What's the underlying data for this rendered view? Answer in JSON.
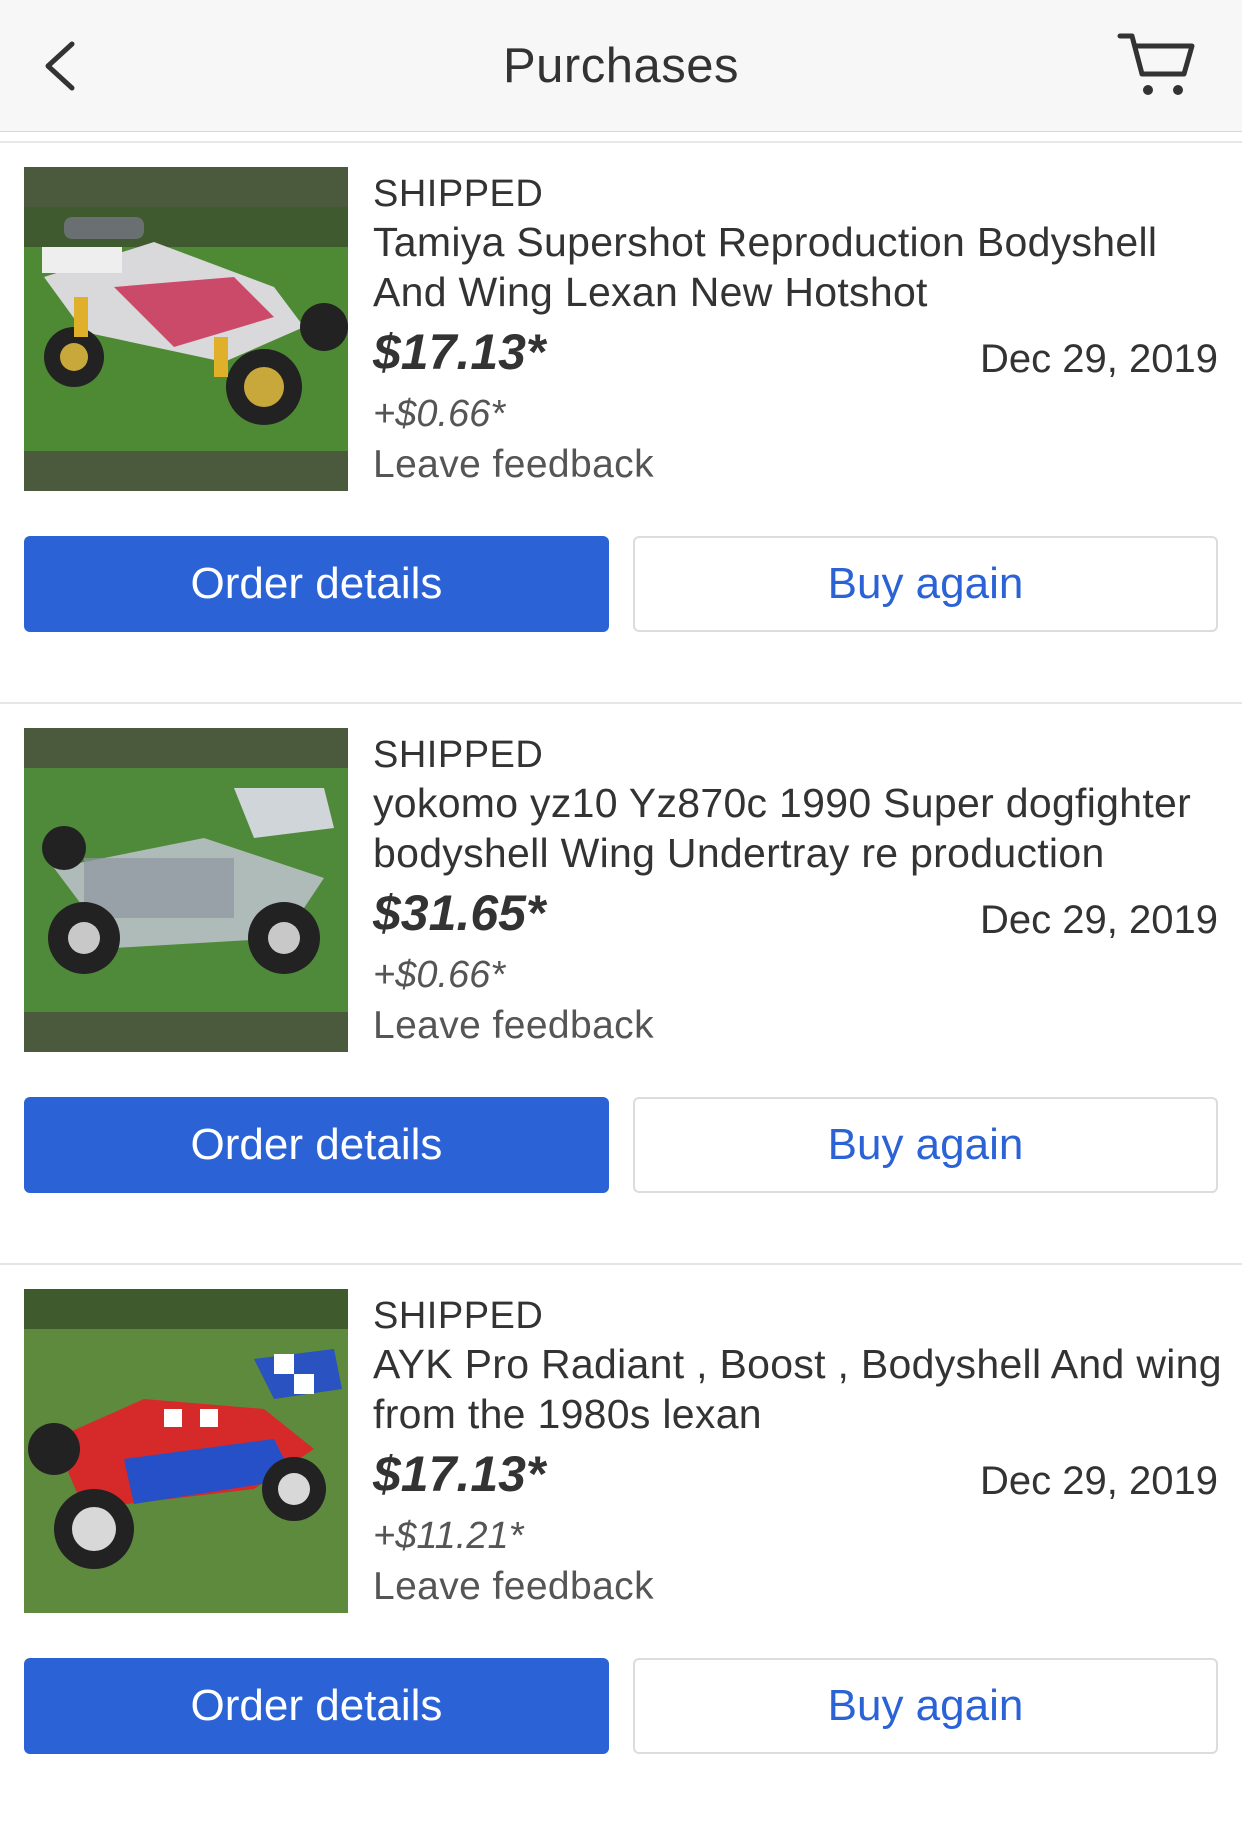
{
  "header": {
    "title": "Purchases",
    "back_icon": "chevron-left-icon",
    "cart_icon": "cart-icon"
  },
  "colors": {
    "primary": "#2b63d6",
    "text": "#333333",
    "nav_bg": "#f7f7f7"
  },
  "purchases": [
    {
      "status": "SHIPPED",
      "title": "Tamiya Supershot Reproduction Bodyshell And Wing Lexan New Hotshot",
      "price": "$17.13*",
      "shipping": "+$0.66*",
      "date": "Dec 29, 2019",
      "feedback": "Leave feedback",
      "order_details_label": "Order details",
      "buy_again_label": "Buy again"
    },
    {
      "status": "SHIPPED",
      "title": "yokomo yz10 Yz870c 1990 Super dogfighter bodyshell Wing Undertray re production",
      "price": "$31.65*",
      "shipping": "+$0.66*",
      "date": "Dec 29, 2019",
      "feedback": "Leave feedback",
      "order_details_label": "Order details",
      "buy_again_label": "Buy again"
    },
    {
      "status": "SHIPPED",
      "title": "AYK Pro Radiant , Boost  , Bodyshell And wing from the 1980s lexan",
      "price": "$17.13*",
      "shipping": "+$11.21*",
      "date": "Dec 29, 2019",
      "feedback": "Leave feedback",
      "order_details_label": "Order details",
      "buy_again_label": "Buy again"
    }
  ]
}
